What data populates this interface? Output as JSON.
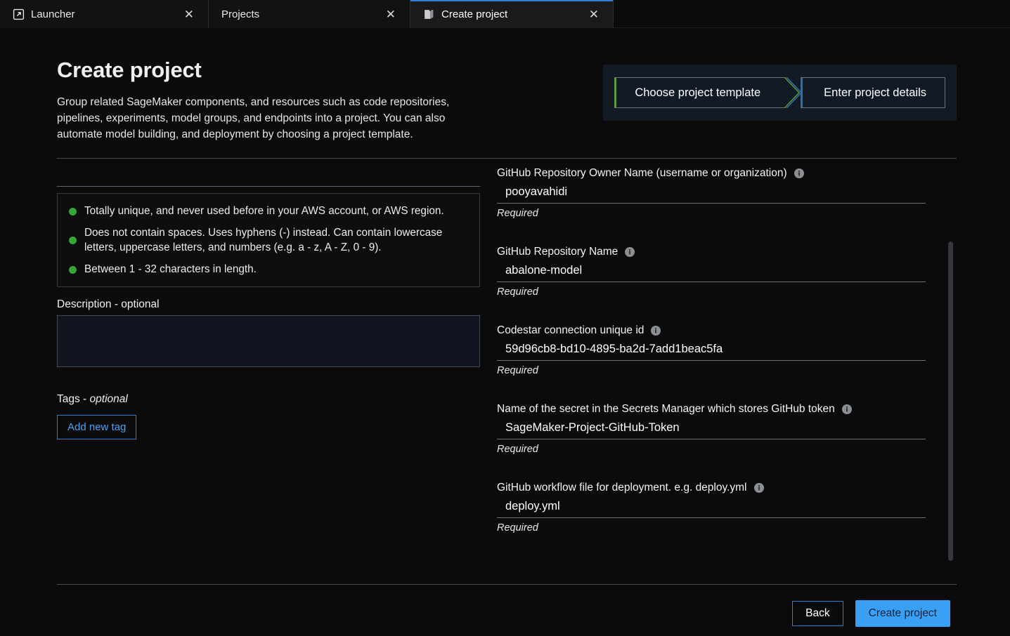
{
  "tabs": [
    {
      "label": "Launcher",
      "icon": "launcher-icon",
      "close": "✕",
      "active": false
    },
    {
      "label": "Projects",
      "icon": "none",
      "close": "✕",
      "active": false
    },
    {
      "label": "Create project",
      "icon": "project-icon",
      "close": "✕",
      "active": true
    }
  ],
  "header": {
    "title": "Create project",
    "description": "Group related SageMaker components, and resources such as code repositories, pipelines, experiments, model groups, and endpoints into a project. You can also automate model building, and deployment by choosing a project template."
  },
  "stepper": {
    "steps": [
      {
        "label": "Choose project template",
        "accent": "#5f9b3a"
      },
      {
        "label": "Enter project details",
        "accent": "#2a6fa8"
      }
    ]
  },
  "left": {
    "name_field": {
      "value": "",
      "placeholder": ""
    },
    "validation": [
      "Totally unique, and never used before in your AWS account, or AWS region.",
      "Does not contain spaces. Uses hyphens (-) instead. Can contain lowercase letters, uppercase letters, and numbers (e.g. a - z, A - Z, 0 - 9).",
      "Between 1 - 32 characters in length."
    ],
    "validation_dot_color": "#37a637",
    "description_label": "Description - optional",
    "description_value": "",
    "tags_label_prefix": "Tags - ",
    "tags_label_italic": "optional",
    "add_tag_label": "Add new tag"
  },
  "right": {
    "fields": [
      {
        "label": "GitHub Repository Owner Name (username or organization)",
        "value": "pooyavahidi",
        "hint": "Required"
      },
      {
        "label": "GitHub Repository Name",
        "value": "abalone-model",
        "hint": "Required"
      },
      {
        "label": "Codestar connection unique id",
        "value": "59d96cb8-bd10-4895-ba2d-7add1beac5fa",
        "hint": "Required"
      },
      {
        "label": "Name of the secret in the Secrets Manager which stores GitHub token",
        "value": "SageMaker-Project-GitHub-Token",
        "hint": "Required"
      },
      {
        "label": "GitHub workflow file for deployment. e.g. deploy.yml",
        "value": "deploy.yml",
        "hint": "Required"
      }
    ]
  },
  "footer": {
    "back_label": "Back",
    "create_label": "Create project"
  },
  "colors": {
    "accent_blue": "#3aa0f5",
    "border_blue": "#2a7fd4",
    "green": "#37a637",
    "page_bg": "#0b0b0c",
    "stepper_bg": "#121a25"
  }
}
